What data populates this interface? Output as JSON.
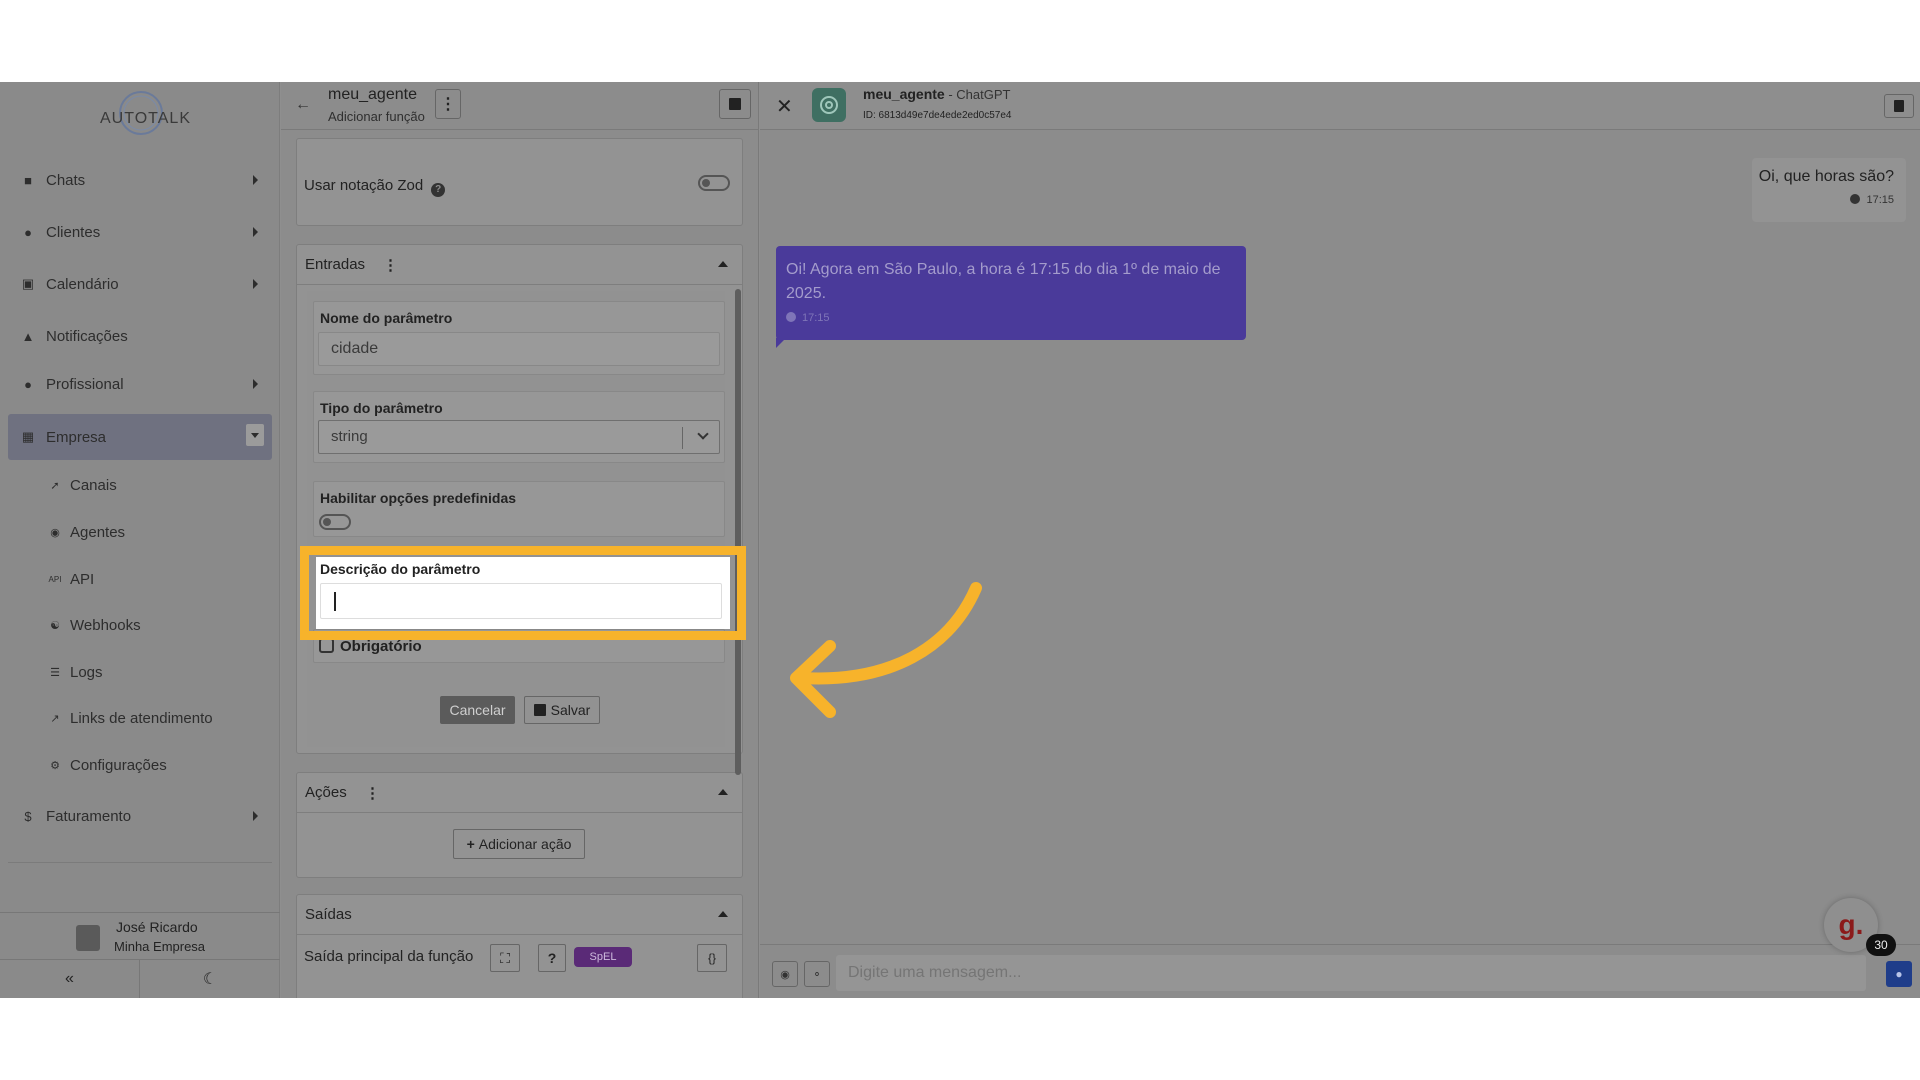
{
  "sidebar": {
    "logo": "AUTOTALK",
    "items": [
      {
        "label": "Chats",
        "icon": "chat-bubble-icon"
      },
      {
        "label": "Clientes",
        "icon": "users-icon"
      },
      {
        "label": "Calendário",
        "icon": "calendar-icon"
      },
      {
        "label": "Notificações",
        "icon": "bell-icon"
      },
      {
        "label": "Profissional",
        "icon": "user-tie-icon"
      },
      {
        "label": "Empresa",
        "icon": "building-icon"
      },
      {
        "label": "Faturamento",
        "icon": "dollar-icon"
      }
    ],
    "subitems": [
      {
        "label": "Canais",
        "icon": "rocket-icon"
      },
      {
        "label": "Agentes",
        "icon": "robot-icon"
      },
      {
        "label": "API",
        "icon": "api-icon",
        "icon_text": "API"
      },
      {
        "label": "Webhooks",
        "icon": "webhook-icon"
      },
      {
        "label": "Logs",
        "icon": "list-icon"
      },
      {
        "label": "Links de atendimento",
        "icon": "external-link-icon"
      },
      {
        "label": "Configurações",
        "icon": "gear-icon"
      }
    ],
    "user": {
      "name": "José Ricardo",
      "company": "Minha Empresa"
    }
  },
  "editor": {
    "title": "meu_agente",
    "subtitle": "Adicionar função",
    "zod_label": "Usar notação Zod",
    "inputs_section": {
      "title": "Entradas",
      "param_name_label": "Nome do parâmetro",
      "param_name_value": "cidade",
      "param_type_label": "Tipo do parâmetro",
      "param_type_value": "string",
      "predefined_label": "Habilitar opções predefinidas",
      "description_label": "Descrição do parâmetro",
      "description_value": "",
      "required_label": "Obrigatório",
      "cancel_label": "Cancelar",
      "save_label": "Salvar"
    },
    "actions_section": {
      "title": "Ações",
      "add_action_label": "Adicionar ação"
    },
    "outputs_section": {
      "title": "Saídas",
      "main_output_label": "Saída principal da função",
      "help_label": "?",
      "spel_label": "SpEL",
      "braces_label": "{}"
    }
  },
  "chat": {
    "agent_name": "meu_agente",
    "model": "ChatGPT",
    "id_text": "ID: 6813d49e7de4ede2ed0c57e4",
    "messages": [
      {
        "role": "user",
        "text": "Oi, que horas são?",
        "time": "17:15"
      },
      {
        "role": "assistant",
        "text": "Oi! Agora em São Paulo, a hora é 17:15 do dia 1º de maio de 2025.",
        "time": "17:15"
      }
    ],
    "input_placeholder": "Digite uma mensagem...",
    "widget_letter": "g.",
    "widget_badge": "30"
  },
  "colors": {
    "highlight": "#f7b32b",
    "assistant_bubble": "#4a3a9a",
    "spel_badge": "#5a2a77"
  }
}
